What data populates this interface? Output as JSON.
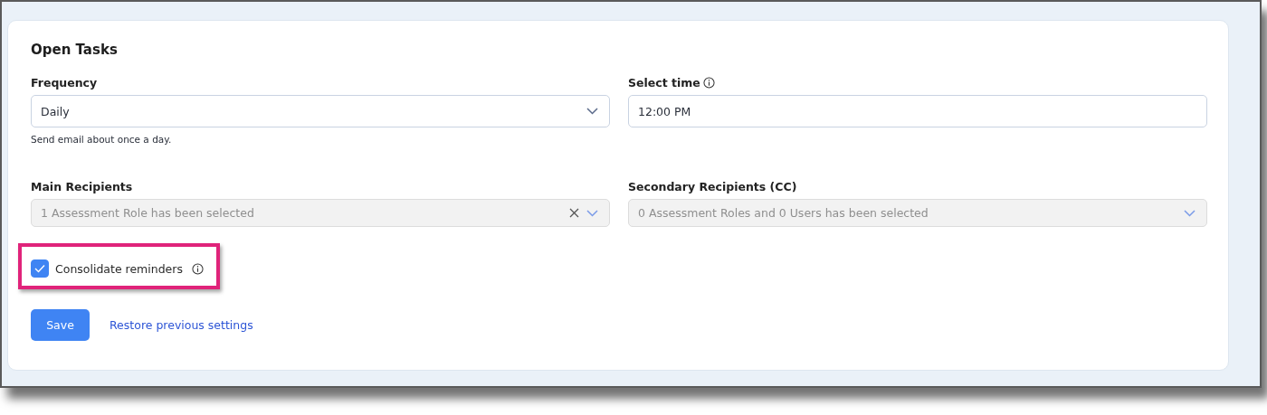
{
  "panel": {
    "title": "Open Tasks",
    "fields": [
      {
        "kind": "select",
        "label": "Frequency",
        "info": false,
        "value": "Daily",
        "disabled": false,
        "clearable": false,
        "hint": "Send email about once a day."
      },
      {
        "kind": "text",
        "label": "Select time",
        "info": true,
        "value": "12:00 PM",
        "disabled": false,
        "clearable": false
      },
      {
        "kind": "select",
        "label": "Main Recipients",
        "info": false,
        "value": "1 Assessment Role has been selected",
        "disabled": true,
        "clearable": true
      },
      {
        "kind": "select",
        "label": "Secondary Recipients (CC)",
        "info": false,
        "value": "0 Assessment Roles and 0 Users has been selected",
        "disabled": true,
        "clearable": false
      }
    ],
    "checkbox": {
      "label": "Consolidate reminders",
      "checked": true,
      "info": true,
      "highlighted": true
    },
    "actions": [
      {
        "kind": "primary",
        "label": "Save"
      },
      {
        "kind": "link",
        "label": "Restore previous settings"
      }
    ]
  }
}
